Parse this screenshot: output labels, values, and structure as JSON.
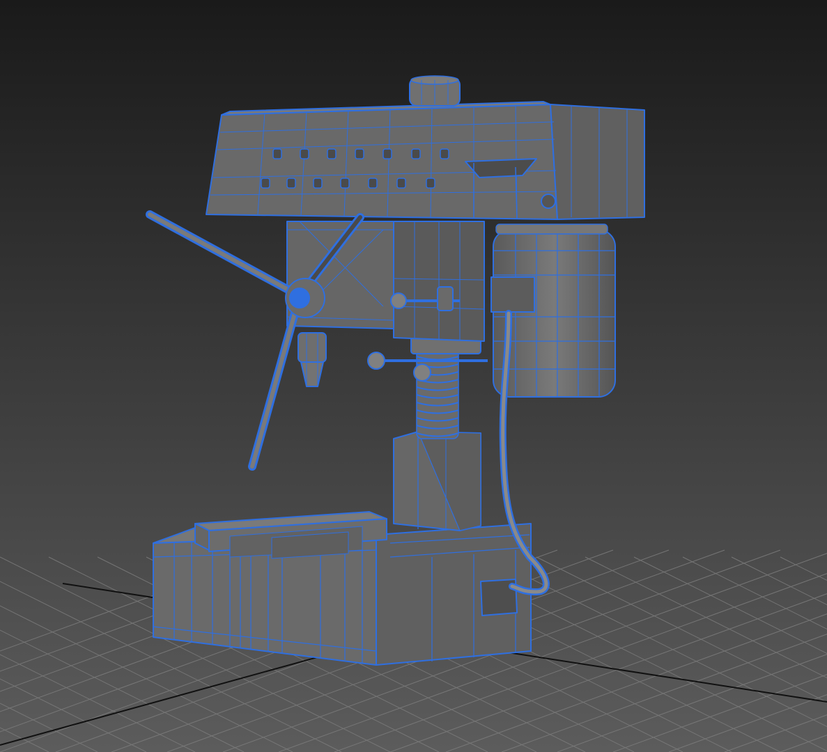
{
  "viewport": {
    "background_top": "#1a1a1a",
    "background_bottom": "#5c5c5c",
    "grid_color": "#7d7d7d",
    "grid_axis_color": "#111111"
  },
  "model": {
    "subject": "drill-press",
    "display_mode": "shaded-with-wireframe",
    "surface_color": "#6e6e6e",
    "wire_color": "#2f6fe0"
  }
}
